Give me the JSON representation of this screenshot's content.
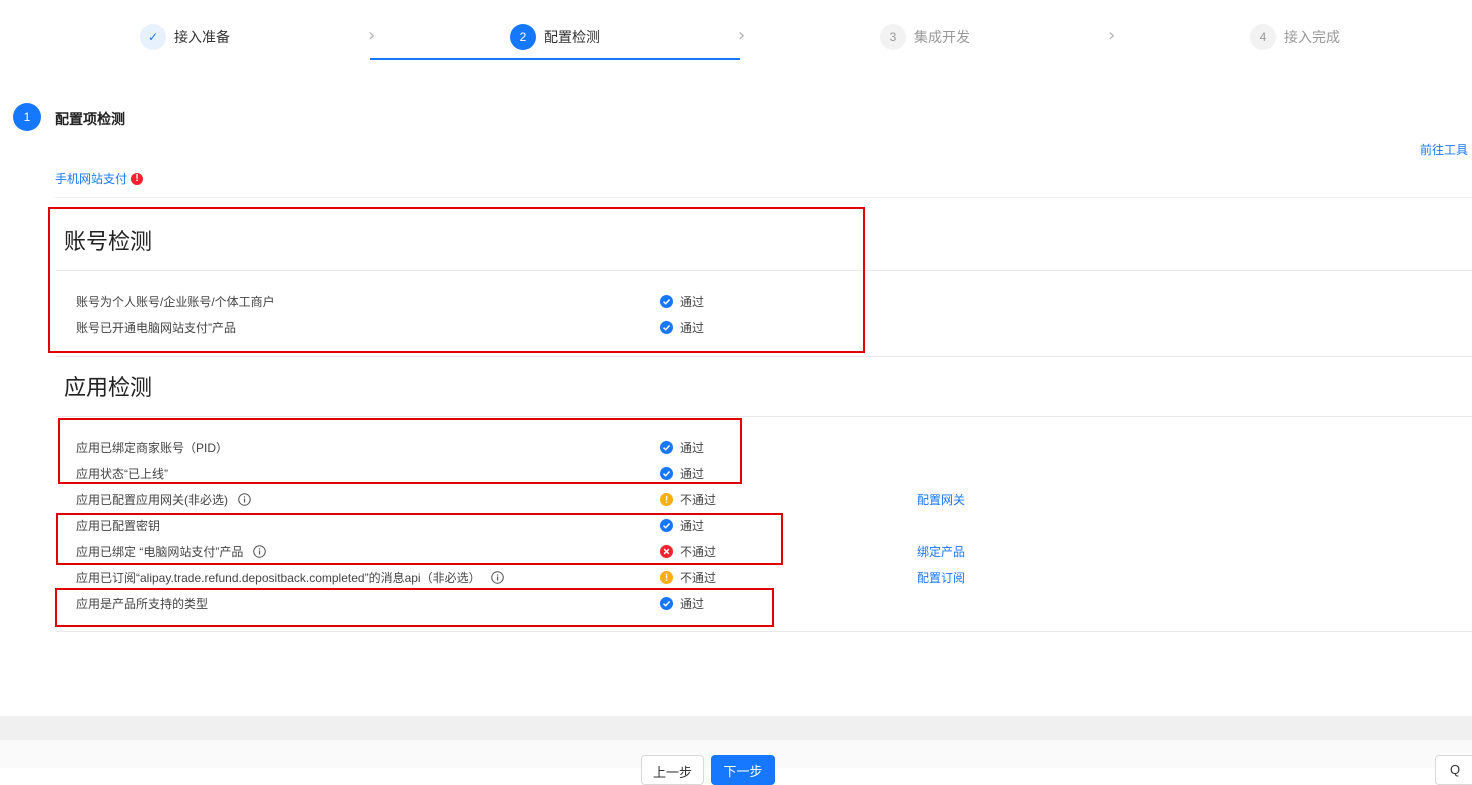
{
  "steps": [
    {
      "num": "✓",
      "label": "接入准备",
      "state": "done"
    },
    {
      "num": "2",
      "label": "配置检测",
      "state": "active"
    },
    {
      "num": "3",
      "label": "集成开发",
      "state": "todo"
    },
    {
      "num": "4",
      "label": "接入完成",
      "state": "todo"
    }
  ],
  "section": {
    "num": "1",
    "title": "配置项检测",
    "tool_link": "前往工具"
  },
  "tab": {
    "label": "手机网站支付",
    "badge": "!"
  },
  "account_group": {
    "title": "账号检测",
    "rows": [
      {
        "label": "账号为个人账号/企业账号/个体工商户",
        "status": "通过",
        "status_type": "pass"
      },
      {
        "label": "账号已开通电脑网站支付”产品",
        "status": "通过",
        "status_type": "pass"
      }
    ]
  },
  "app_group": {
    "title": "应用检测",
    "rows": [
      {
        "label": "应用已绑定商家账号（PID）",
        "status": "通过",
        "status_type": "pass",
        "link": ""
      },
      {
        "label": "应用状态“已上线”",
        "status": "通过",
        "status_type": "pass",
        "link": ""
      },
      {
        "label": "应用已配置应用网关(非必选)",
        "status": "不通过",
        "status_type": "warn",
        "link": "配置网关",
        "info": true
      },
      {
        "label": "应用已配置密钥",
        "status": "通过",
        "status_type": "pass",
        "link": ""
      },
      {
        "label": "应用已绑定 “电脑网站支付”产品",
        "status": "不通过",
        "status_type": "fail",
        "link": "绑定产品",
        "info": true
      },
      {
        "label": "应用已订阅“alipay.trade.refund.depositback.completed”的消息api（非必选）",
        "status": "不通过",
        "status_type": "warn",
        "link": "配置订阅",
        "info": true
      },
      {
        "label": "应用是产品所支持的类型",
        "status": "通过",
        "status_type": "pass",
        "link": ""
      }
    ]
  },
  "footer": {
    "prev_label": "上一步",
    "next_label": "下一步",
    "right_label": "Q"
  },
  "colors": {
    "primary": "#1677ff",
    "pass": "#1677ff",
    "warn": "#faad14",
    "fail": "#f5222d",
    "highlight": "#e00000"
  }
}
